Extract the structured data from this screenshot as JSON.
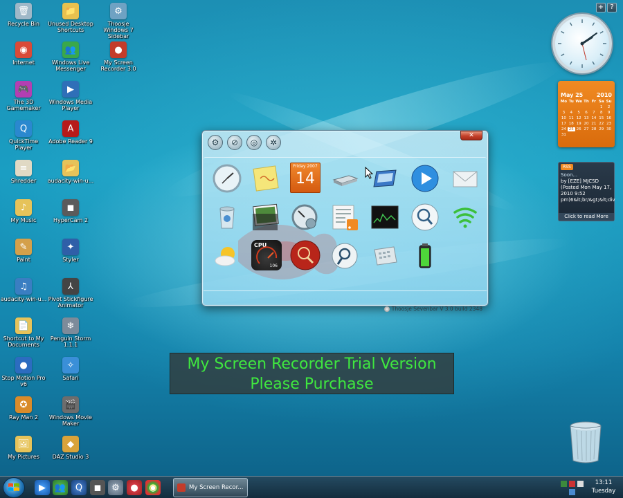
{
  "desktop_icons": [
    {
      "label": "Recycle Bin",
      "icon": "recycle-bin-icon",
      "color": "#9fb8c8",
      "glyph": "🗑"
    },
    {
      "label": "Unused Desktop Shortcuts",
      "icon": "folder-icon",
      "color": "#e8c14e",
      "glyph": "📁"
    },
    {
      "label": "Thoosje Windows 7 Sidebar",
      "icon": "sidebar-icon",
      "color": "#6fa2c3",
      "glyph": "⚙"
    },
    {
      "label": "Internet",
      "icon": "chrome-icon",
      "color": "#d94a38",
      "glyph": "◉"
    },
    {
      "label": "Windows Live Messenger",
      "icon": "messenger-icon",
      "color": "#3aa84a",
      "glyph": "👥"
    },
    {
      "label": "My Screen Recorder 3.0",
      "icon": "screen-recorder-icon",
      "color": "#c43c2a",
      "glyph": "●"
    },
    {
      "label": "The 3D Gamemaker",
      "icon": "gamemaker-icon",
      "color": "#b33fb2",
      "glyph": "🎮"
    },
    {
      "label": "Windows Media Player",
      "icon": "media-player-icon",
      "color": "#2f6fb8",
      "glyph": "▶"
    },
    {
      "label": "QuickTime Player",
      "icon": "quicktime-icon",
      "color": "#2a88cf",
      "glyph": "Q"
    },
    {
      "label": "Adobe Reader 9",
      "icon": "adobe-reader-icon",
      "color": "#b71a1a",
      "glyph": "A"
    },
    {
      "label": "Shredder",
      "icon": "shredder-icon",
      "color": "#e0d9c4",
      "glyph": "≡"
    },
    {
      "label": "audacity-win-u...",
      "icon": "zip-folder-icon",
      "color": "#e6c35a",
      "glyph": "📂"
    },
    {
      "label": "My Music",
      "icon": "music-folder-icon",
      "color": "#e6c35a",
      "glyph": "♪"
    },
    {
      "label": "HyperCam 2",
      "icon": "hypercam-icon",
      "color": "#5b5b5b",
      "glyph": "◼"
    },
    {
      "label": "Paint",
      "icon": "paint-icon",
      "color": "#d4a04a",
      "glyph": "✎"
    },
    {
      "label": "Styler",
      "icon": "styler-icon",
      "color": "#2f5fa8",
      "glyph": "✦"
    },
    {
      "label": "audacity-win-u...",
      "icon": "audacity-icon",
      "color": "#3a7ec2",
      "glyph": "♫"
    },
    {
      "label": "Pivot Stickfigure Animator",
      "icon": "pivot-icon",
      "color": "#444444",
      "glyph": "⅄"
    },
    {
      "label": "Shortcut to My Documents",
      "icon": "documents-icon",
      "color": "#e6c35a",
      "glyph": "📄"
    },
    {
      "label": "Penguin Storm 1.1.1",
      "icon": "penguin-storm-icon",
      "color": "#7d8b9a",
      "glyph": "❄"
    },
    {
      "label": "Stop Motion Pro v6",
      "icon": "stop-motion-icon",
      "color": "#2c6cc0",
      "glyph": "●"
    },
    {
      "label": "Safari",
      "icon": "safari-icon",
      "color": "#3a8fd8",
      "glyph": "✧"
    },
    {
      "label": "Ray Man 2",
      "icon": "rayman-icon",
      "color": "#d98b2a",
      "glyph": "✪"
    },
    {
      "label": "Windows Movie Maker",
      "icon": "movie-maker-icon",
      "color": "#6d6d6d",
      "glyph": "🎬"
    },
    {
      "label": "My Pictures",
      "icon": "pictures-folder-icon",
      "color": "#e6c35a",
      "glyph": "🖼"
    },
    {
      "label": "DAZ Studio 3",
      "icon": "daz-studio-icon",
      "color": "#d9a33a",
      "glyph": "◆"
    }
  ],
  "gadgets": {
    "clock_time": "13:11",
    "calendar": {
      "month_label": "May 25",
      "year": "2010",
      "weekdays": [
        "Mo",
        "Tu",
        "We",
        "Th",
        "Fr",
        "Sa",
        "Su"
      ],
      "days": [
        "",
        "",
        "",
        "",
        "",
        "1",
        "2",
        "3",
        "4",
        "5",
        "6",
        "7",
        "8",
        "9",
        "10",
        "11",
        "12",
        "13",
        "14",
        "15",
        "16",
        "17",
        "18",
        "19",
        "20",
        "21",
        "22",
        "23",
        "24",
        "25",
        "26",
        "27",
        "28",
        "29",
        "30",
        "31"
      ],
      "selected_day": "25",
      "accent": "#e07a16"
    },
    "rss": {
      "badge": "RSS",
      "title": "Soon...",
      "body": "by [EZE] MJCSD (Posted Mon May 17, 2010 9:52 pm)6&lt;br/&gt;&lt;div",
      "more": "Click to read More"
    },
    "controls": {
      "add": "+",
      "help": "?"
    }
  },
  "sevenbar": {
    "close": "✕",
    "toolbar": [
      {
        "name": "settings-tool-icon",
        "glyph": "⚙"
      },
      {
        "name": "no-entry-tool-icon",
        "glyph": "⊘"
      },
      {
        "name": "monitor-tool-icon",
        "glyph": "◎"
      },
      {
        "name": "gear-tool-icon",
        "glyph": "✲"
      }
    ],
    "calendar_tile": {
      "day": "Friday 2007",
      "date": "14"
    },
    "cpu_label": "CPU",
    "cpu_value": "106",
    "footer": "Thoosje Sevenbar V 3.0  build 2348"
  },
  "trial_banner": {
    "line1": "My Screen Recorder Trial Version",
    "line2": "Please Purchase"
  },
  "taskbar": {
    "task_label": "My Screen Recor...",
    "time": "13:11",
    "day": "Tuesday"
  }
}
